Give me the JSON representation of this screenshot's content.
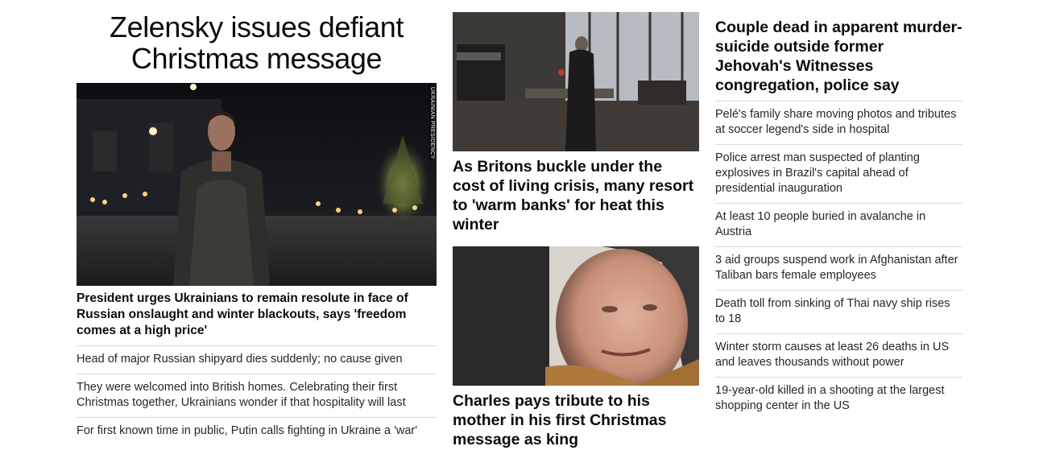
{
  "col1": {
    "headline": "Zelensky issues defiant Christmas message",
    "image_credit": "UKRAINIAN PRESIDENCY",
    "lead": "President urges Ukrainians to remain resolute in face of Russian onslaught and winter blackouts, says 'freedom comes at a high price'",
    "items": [
      "Head of major Russian shipyard dies suddenly; no cause given",
      "They were welcomed into British homes. Celebrating their first Christmas together, Ukrainians wonder if that hospitality will last",
      "For first known time in public, Putin calls fighting in Ukraine a 'war'"
    ]
  },
  "col2": {
    "story1": "As Britons buckle under the cost of living crisis, many resort to 'warm banks' for heat this winter",
    "story2": "Charles pays tribute to his mother in his first Christmas message as king"
  },
  "col3": {
    "headline": "Couple dead in apparent murder-suicide outside former Jehovah's Witnesses congregation, police say",
    "items": [
      "Pelé's family share moving photos and tributes at soccer legend's side in hospital",
      "Police arrest man suspected of planting explosives in Brazil's capital ahead of presidential inauguration",
      "At least 10 people buried in avalanche in Austria",
      "3 aid groups suspend work in Afghanistan after Taliban bars female employees",
      "Death toll from sinking of Thai navy ship rises to 18",
      "Winter storm causes at least 26 deaths in US and leaves thousands without power",
      "19-year-old killed in a shooting at the largest shopping center in the US"
    ]
  }
}
